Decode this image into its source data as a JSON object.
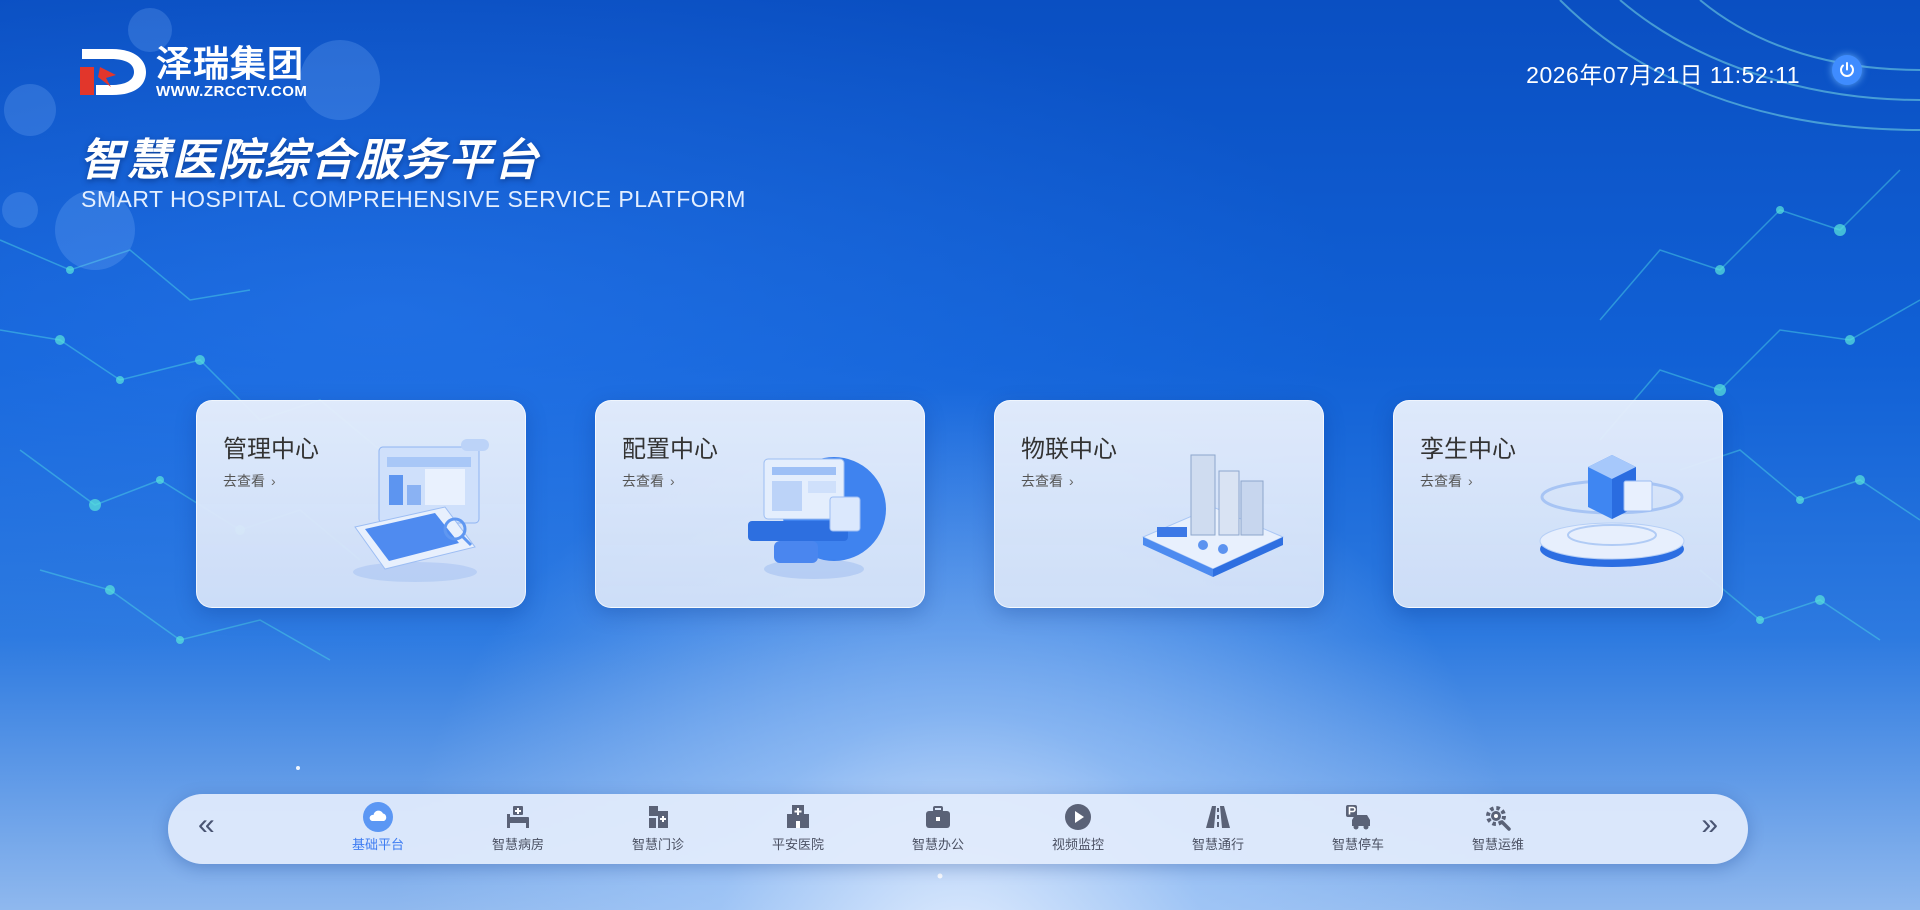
{
  "brand": {
    "name": "泽瑞集团",
    "url": "WWW.ZRCCTV.COM",
    "title_cn": "智慧医院综合服务平台",
    "title_en": "SMART HOSPITAL COMPREHENSIVE SERVICE PLATFORM"
  },
  "header": {
    "datetime": "2026年07月21日  11:52:11",
    "power_icon": "power-icon"
  },
  "cards": [
    {
      "title": "管理中心",
      "link": "去查看",
      "illustration": "laptop-dashboard"
    },
    {
      "title": "配置中心",
      "link": "去查看",
      "illustration": "config-screens"
    },
    {
      "title": "物联中心",
      "link": "去查看",
      "illustration": "iot-city"
    },
    {
      "title": "孪生中心",
      "link": "去查看",
      "illustration": "twin-cube"
    }
  ],
  "nav": {
    "prev": "«",
    "next": "»",
    "items": [
      {
        "label": "基础平台",
        "icon": "cloud-icon",
        "active": true
      },
      {
        "label": "智慧病房",
        "icon": "hospital-bed-icon"
      },
      {
        "label": "智慧门诊",
        "icon": "clinic-icon"
      },
      {
        "label": "平安医院",
        "icon": "hospital-building-icon"
      },
      {
        "label": "智慧办公",
        "icon": "briefcase-icon"
      },
      {
        "label": "视频监控",
        "icon": "play-icon"
      },
      {
        "label": "智慧通行",
        "icon": "road-icon"
      },
      {
        "label": "智慧停车",
        "icon": "parking-icon"
      },
      {
        "label": "智慧运维",
        "icon": "gear-wrench-icon"
      }
    ]
  },
  "colors": {
    "accent": "#3d7cf2",
    "background_top": "#0a4fc2",
    "card_bg": "#e7effc"
  }
}
